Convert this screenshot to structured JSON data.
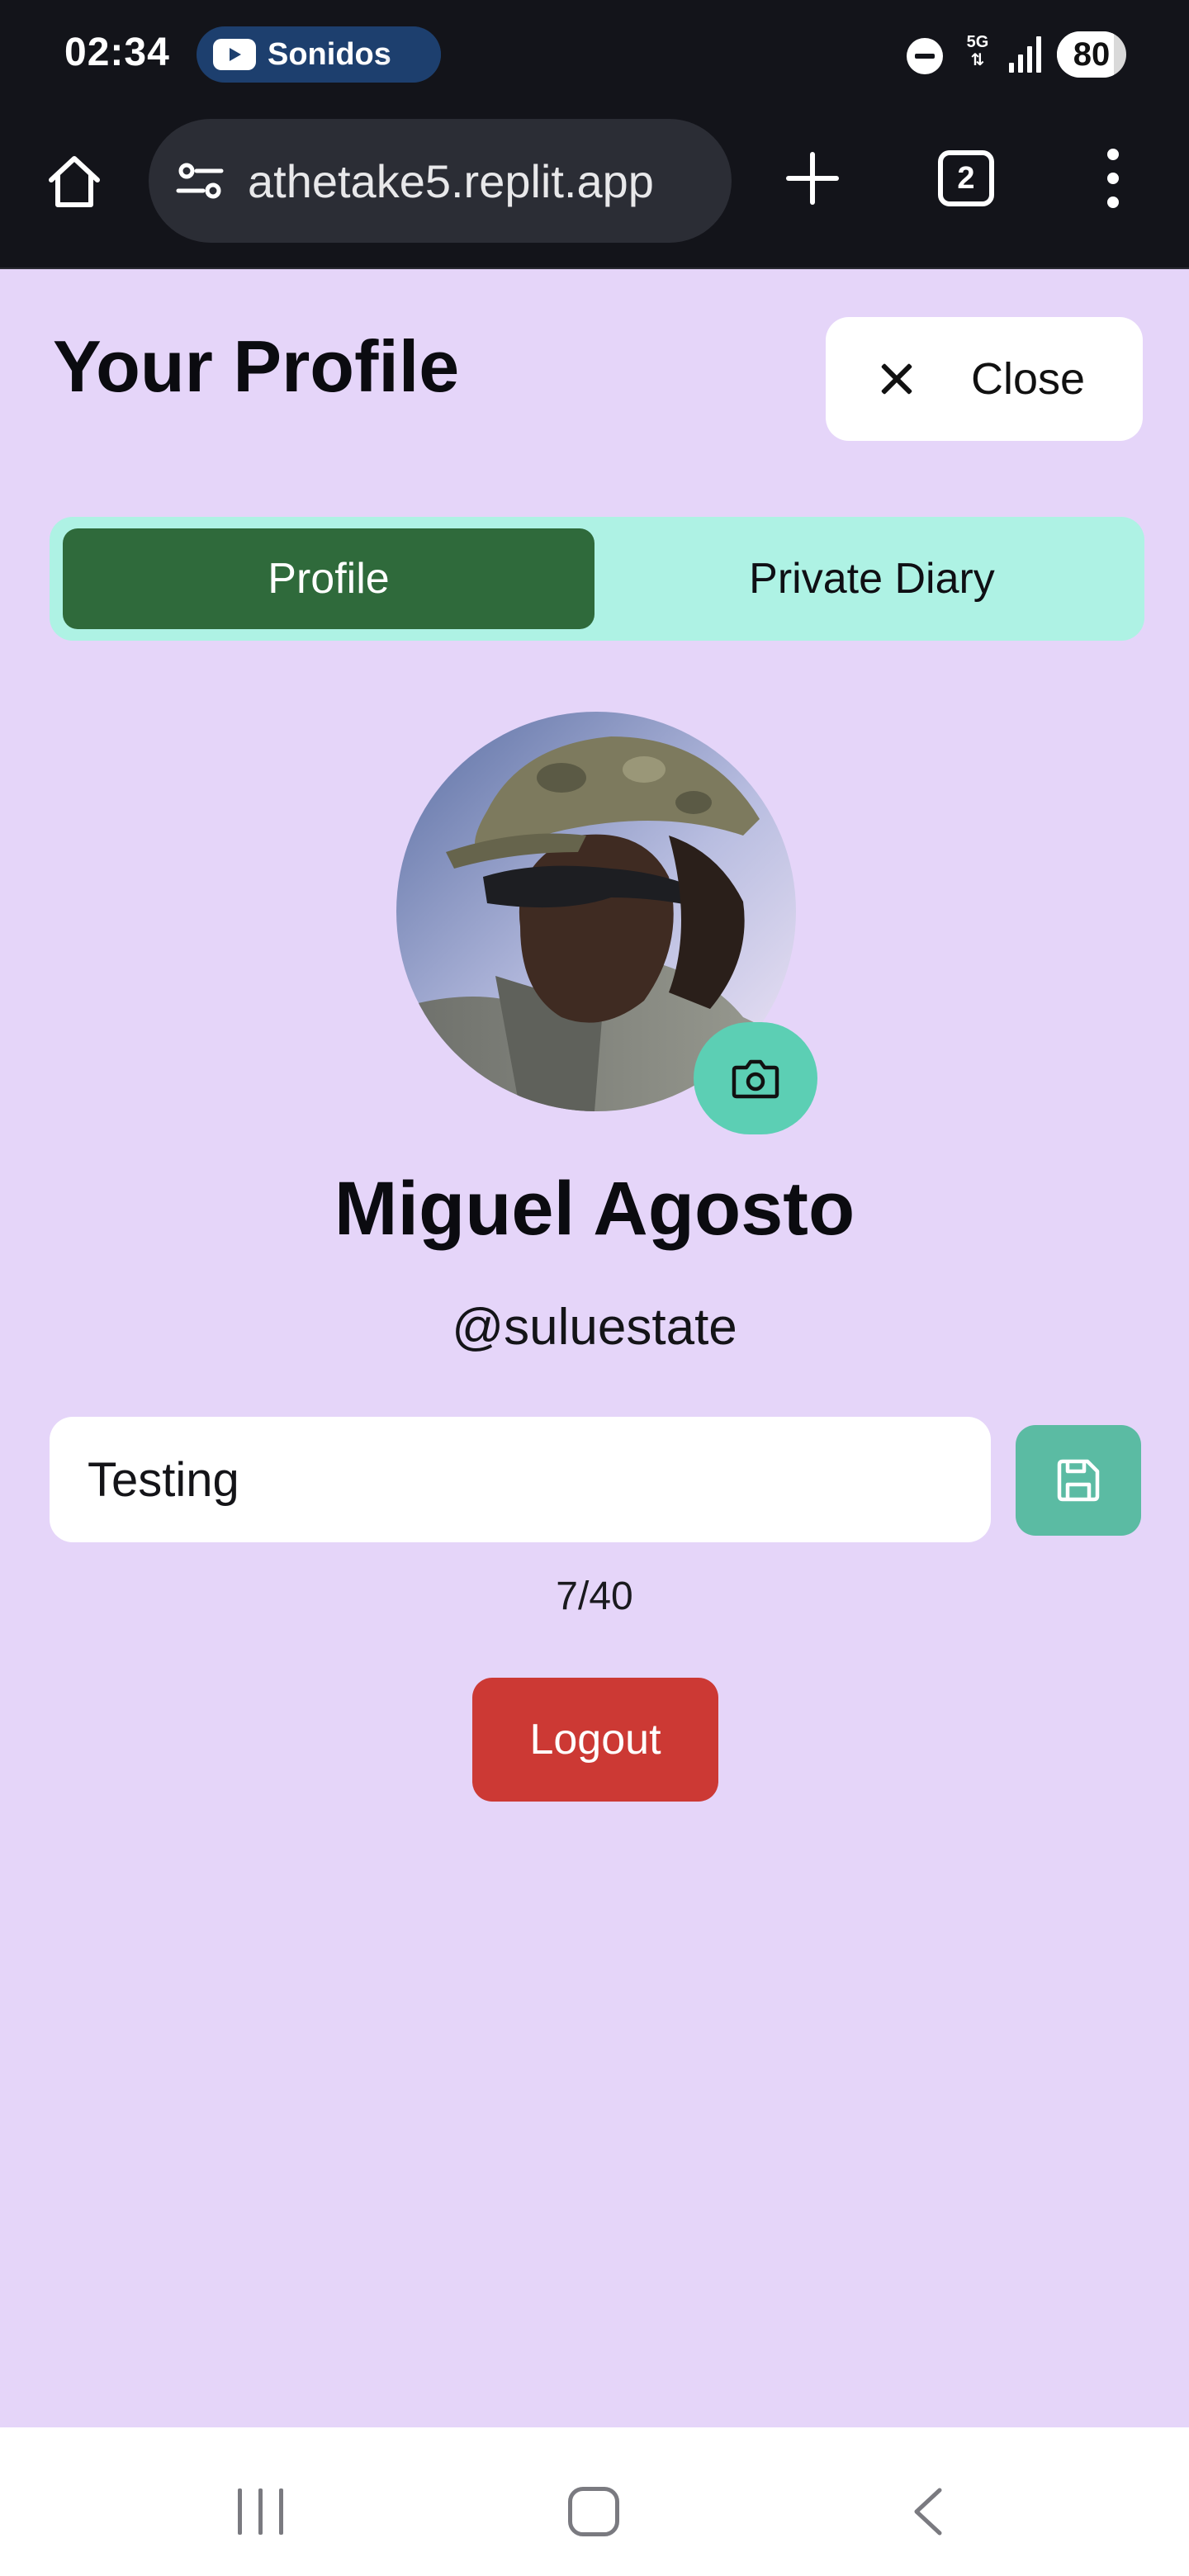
{
  "status_bar": {
    "time": "02:34",
    "media_app": "Sonidos",
    "network": "5G",
    "battery": "80"
  },
  "browser": {
    "url": "athetake5.replit.app",
    "tab_count": "2"
  },
  "header": {
    "title": "Your Profile",
    "close_label": "Close"
  },
  "tabs": [
    {
      "label": "Profile",
      "active": true
    },
    {
      "label": "Private Diary",
      "active": false
    }
  ],
  "profile": {
    "name": "Miguel Agosto",
    "handle": "@suluestate",
    "status_value": "Testing",
    "char_count": "7/40",
    "logout_label": "Logout"
  },
  "colors": {
    "page_background": "#e5d5f9",
    "tab_track": "#aef2e4",
    "tab_active": "#2f6a3b",
    "accent_teal": "#5ccfb4",
    "logout_red": "#cc3934"
  }
}
